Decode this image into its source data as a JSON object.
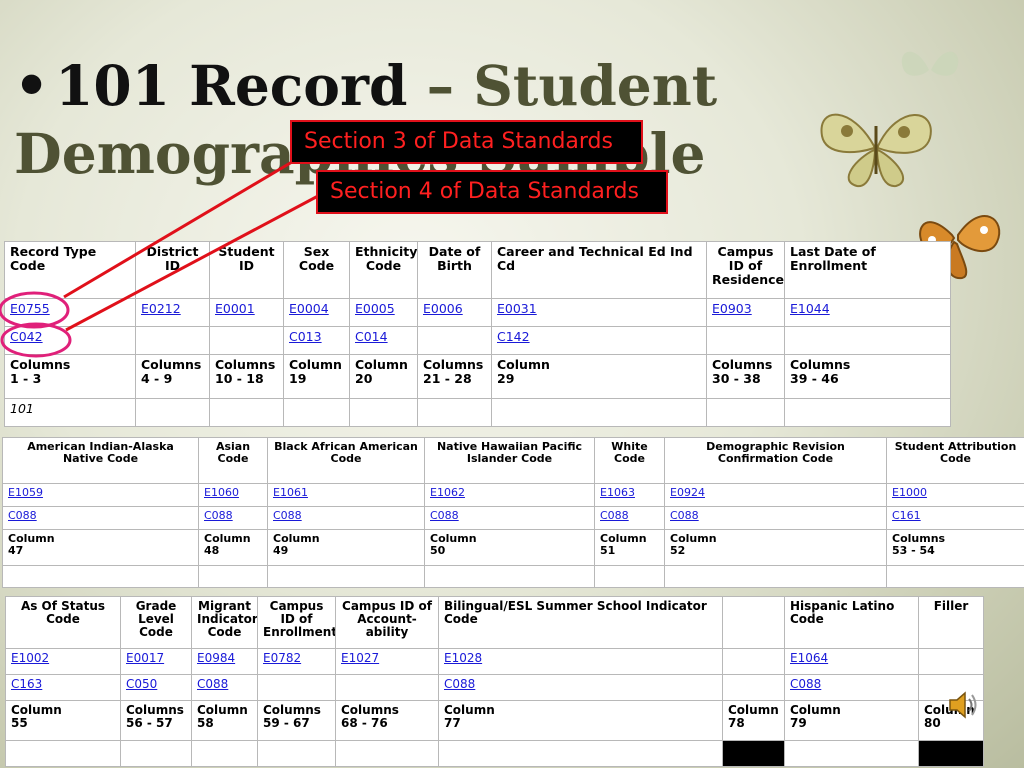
{
  "slide": {
    "title_bullet": "•",
    "title_bold": "101 Record",
    "title_rest": " – Student Demographics Sample"
  },
  "callouts": {
    "section3": "Section 3 of Data Standards",
    "section4": "Section 4 of Data Standards"
  },
  "table1": {
    "headers": [
      "Record Type Code",
      "District ID",
      "Student ID",
      "Sex Code",
      "Ethnicity Code",
      "Date of Birth",
      "Career and Technical Ed Ind Cd",
      "Campus ID of Residence",
      "Last Date of Enrollment"
    ],
    "elements": [
      "E0755",
      "E0212",
      "E0001",
      "E0004",
      "E0005",
      "E0006",
      "E0031",
      "E0903",
      "E1044"
    ],
    "codes": [
      "C042",
      "",
      "",
      "C013",
      "C014",
      "",
      "C142",
      "",
      ""
    ],
    "columns": [
      [
        "Columns",
        "1 - 3"
      ],
      [
        "Columns",
        "4 - 9"
      ],
      [
        "Columns",
        "10 - 18"
      ],
      [
        "Column",
        "19"
      ],
      [
        "Column",
        "20"
      ],
      [
        "Columns",
        "21 - 28"
      ],
      [
        "Column",
        "29"
      ],
      [
        "Columns",
        "30 - 38"
      ],
      [
        "Columns",
        "39 - 46"
      ]
    ],
    "sample": [
      "101",
      "",
      "",
      "",
      "",
      "",
      "",
      "",
      ""
    ]
  },
  "table2": {
    "headers": [
      "American Indian-Alaska Native Code",
      "Asian Code",
      "Black African American Code",
      "Native Hawaiian Pacific Islander Code",
      "White Code",
      "Demographic Revision Confirmation Code",
      "Student Attribution Code"
    ],
    "elements": [
      "E1059",
      "E1060",
      "E1061",
      "E1062",
      "E1063",
      "E0924",
      "E1000"
    ],
    "codes": [
      "C088",
      "C088",
      "C088",
      "C088",
      "C088",
      "C088",
      "C161"
    ],
    "columns": [
      [
        "Column",
        "47"
      ],
      [
        "Column",
        "48"
      ],
      [
        "Column",
        "49"
      ],
      [
        "Column",
        "50"
      ],
      [
        "Column",
        "51"
      ],
      [
        "Column",
        "52"
      ],
      [
        "Columns",
        "53 - 54"
      ]
    ]
  },
  "table3": {
    "headers": [
      "As Of Status Code",
      "Grade Level Code",
      "Migrant Indicator Code",
      "Campus ID of Enrollment",
      "Campus ID of Account-ability",
      "Bilingual/ESL Summer School Indicator Code",
      "",
      "Hispanic Latino Code",
      "Filler"
    ],
    "elements": [
      "E1002",
      "E0017",
      "E0984",
      "E0782",
      "E1027",
      "E1028",
      "",
      "E1064",
      ""
    ],
    "codes": [
      "C163",
      "C050",
      "C088",
      "",
      "",
      "C088",
      "",
      "C088",
      ""
    ],
    "columns": [
      [
        "Column",
        "55"
      ],
      [
        "Columns",
        "56 - 57"
      ],
      [
        "Column",
        "58"
      ],
      [
        "Columns",
        "59 - 67"
      ],
      [
        "Columns",
        "68 - 76"
      ],
      [
        "Column",
        "77"
      ],
      [
        "Column",
        "78"
      ],
      [
        "Column",
        "79"
      ],
      [
        "Column",
        "80"
      ]
    ]
  },
  "colors": {
    "callout_text": "#ff2020",
    "callout_bg": "#000000",
    "pointer_line": "#e0101a",
    "highlight_ellipse": "#e0207a",
    "link": "#1a1ad8"
  },
  "icons": [
    "butterfly-icon",
    "speaker-icon"
  ]
}
